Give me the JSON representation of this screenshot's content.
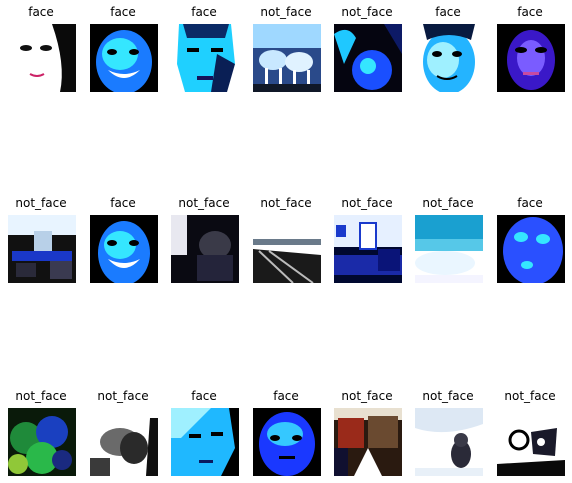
{
  "figure": {
    "rows": [
      [
        "face",
        "face",
        "face",
        "not_face",
        "not_face",
        "face",
        "face"
      ],
      [
        "not_face",
        "face",
        "not_face",
        "not_face",
        "not_face",
        "not_face",
        "face"
      ],
      [
        "not_face",
        "not_face",
        "face",
        "face",
        "not_face",
        "not_face",
        "not_face"
      ]
    ]
  }
}
